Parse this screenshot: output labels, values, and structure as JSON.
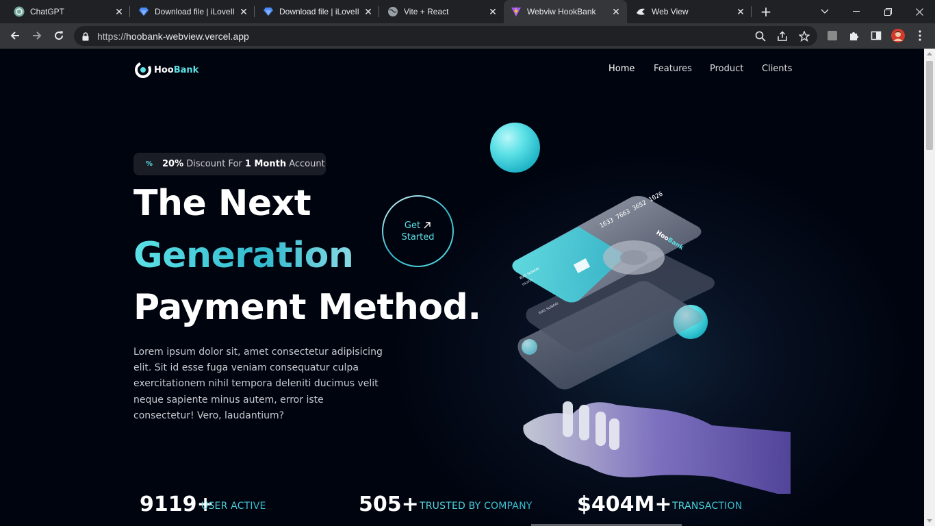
{
  "browser": {
    "tabs": [
      {
        "title": "ChatGPT",
        "icon": "chatgpt-icon"
      },
      {
        "title": "Download file | iLoveIl",
        "icon": "ilovepdf-icon"
      },
      {
        "title": "Download file | iLoveIl",
        "icon": "ilovepdf-icon"
      },
      {
        "title": "Vite + React",
        "icon": "globe-icon"
      },
      {
        "title": "Webviw HookBank",
        "icon": "vite-icon",
        "active": true
      },
      {
        "title": "Web View",
        "icon": "webview-icon"
      }
    ],
    "url_scheme": "https://",
    "url_host": "hoobank-webview.vercel.app"
  },
  "site": {
    "logo_part1": "Hoo",
    "logo_part2": "Bank",
    "nav": [
      "Home",
      "Features",
      "Product",
      "Clients"
    ],
    "badge": {
      "pct_symbol": "%",
      "pre": "20%",
      "mid1": " Discount For ",
      "bold2": "1 Month",
      "post": " Account"
    },
    "heading": [
      "The Next",
      "Generation",
      "Payment Method."
    ],
    "paragraph": "Lorem ipsum dolor sit, amet consectetur adipisicing elit. Sit id esse fuga veniam consequatur culpa exercitationem nihil tempora deleniti ducimus velit neque sapiente minus autem, error iste consectetur! Vero, laudantium?",
    "cta": {
      "line1": "Get",
      "line2": "Started"
    },
    "card": {
      "number": "1633 7663 3652 1026",
      "brand_part1": "Hoo",
      "brand_part2": "Bank",
      "holder": "WAS SUNARI",
      "expiry": "09/2023"
    },
    "stats": [
      {
        "value": "9119+",
        "label": "USER ACTIVE"
      },
      {
        "value": "505+",
        "label": "TRUSTED BY COMPANY"
      },
      {
        "value": "$404M+",
        "label": "TRANSACTION"
      }
    ]
  },
  "colors": {
    "accent": "#5ce1e6",
    "background": "#00040f",
    "chrome_dark": "#202124",
    "chrome_mid": "#35363a"
  }
}
